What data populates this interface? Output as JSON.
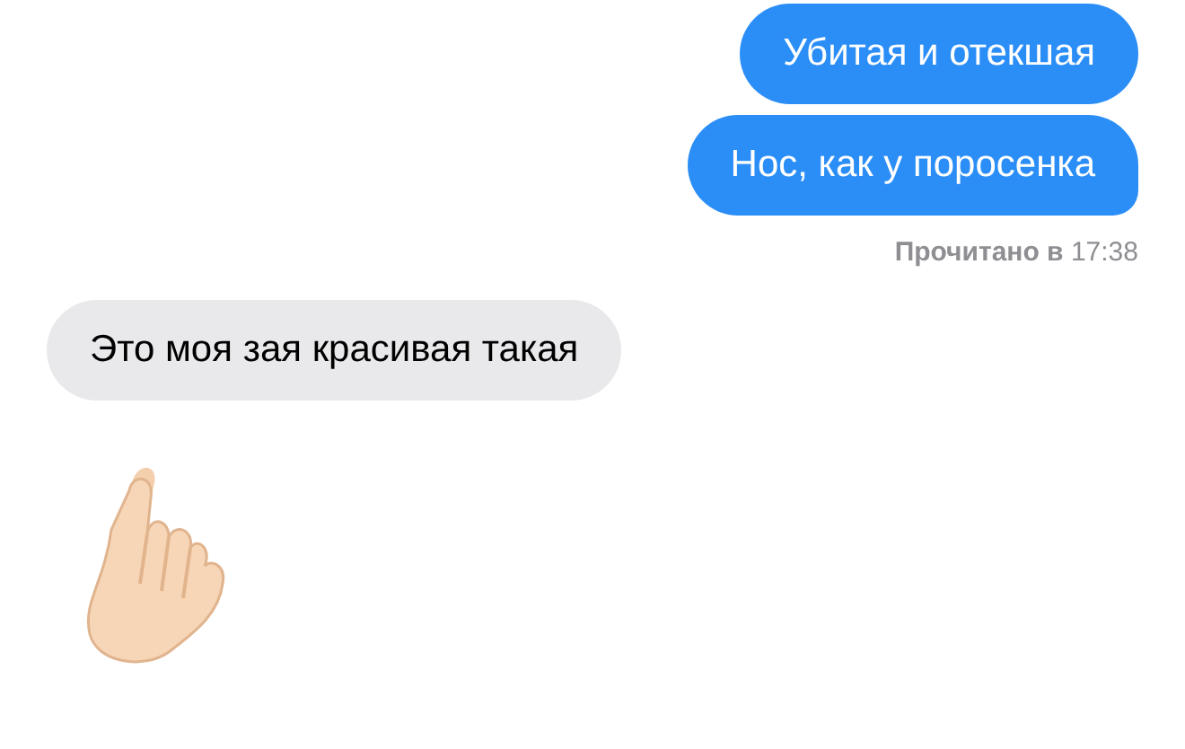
{
  "messages": [
    {
      "kind": "text",
      "outgoing": true,
      "tail": false,
      "text": "Убитая и отекшая"
    },
    {
      "kind": "text",
      "outgoing": true,
      "tail": true,
      "text": "Нос, как у поросенка"
    },
    {
      "kind": "receipt",
      "text": "**Прочитано в** 17:38"
    },
    {
      "kind": "text",
      "outgoing": false,
      "tail": false,
      "text": "Это моя зая красивая такая"
    },
    {
      "kind": "emoji",
      "outgoing": false
    }
  ]
}
